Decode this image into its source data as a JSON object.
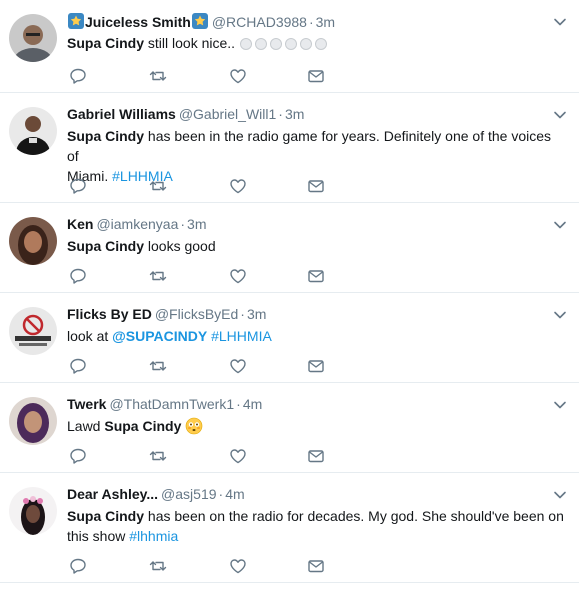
{
  "colors": {
    "text": "#14171a",
    "muted": "#657786",
    "link": "#1b95e0",
    "divider": "#e6ecf0",
    "icon": "#657786"
  },
  "tweets": [
    {
      "name": "Juiceless Smith",
      "handle": "@RCHAD3988",
      "time": "3m",
      "name_decoration": "star-emoji",
      "parts": [
        {
          "t": "Supa Cindy",
          "style": "bold"
        },
        {
          "t": " still look nice..",
          "style": "plain"
        }
      ],
      "trailing_emoji_count": 6
    },
    {
      "name": "Gabriel Williams",
      "handle": "@Gabriel_Will1",
      "time": "3m",
      "parts": [
        {
          "t": "Supa Cindy",
          "style": "bold"
        },
        {
          "t": " has been in the radio game for years. Definitely one of the voices of",
          "style": "plain"
        }
      ],
      "line2": [
        {
          "t": "Miami. ",
          "style": "plain"
        },
        {
          "t": "#LHHMIA",
          "style": "hashtag"
        }
      ]
    },
    {
      "name": "Ken",
      "handle": "@iamkenyaa",
      "time": "3m",
      "parts": [
        {
          "t": "Supa Cindy",
          "style": "bold"
        },
        {
          "t": " looks good",
          "style": "plain"
        }
      ]
    },
    {
      "name": "Flicks By ED",
      "handle": "@FlicksByEd",
      "time": "3m",
      "avatar_text": "FLICKS BY ED",
      "parts": [
        {
          "t": "look at ",
          "style": "plain"
        },
        {
          "t": "@SUPACINDY",
          "style": "mention"
        },
        {
          "t": " ",
          "style": "plain"
        },
        {
          "t": "#LHHMIA",
          "style": "hashtag"
        }
      ]
    },
    {
      "name": "Twerk",
      "handle": "@ThatDamnTwerk1",
      "time": "4m",
      "parts": [
        {
          "t": "Lawd ",
          "style": "plain"
        },
        {
          "t": "Supa Cindy",
          "style": "bold"
        },
        {
          "t": " ",
          "style": "plain"
        }
      ],
      "trailing_emoji": "flushed-face-emoji"
    },
    {
      "name": "Dear Ashley...",
      "handle": "@asj519",
      "time": "4m",
      "parts": [
        {
          "t": "Supa Cindy",
          "style": "bold"
        },
        {
          "t": " has been on the radio for decades. My god. She should've been on",
          "style": "plain"
        }
      ],
      "line2": [
        {
          "t": "this show ",
          "style": "plain"
        },
        {
          "t": "#lhhmia",
          "style": "hashtag"
        }
      ]
    }
  ],
  "actions": [
    "reply-icon",
    "retweet-icon",
    "like-icon",
    "direct-message-icon"
  ]
}
